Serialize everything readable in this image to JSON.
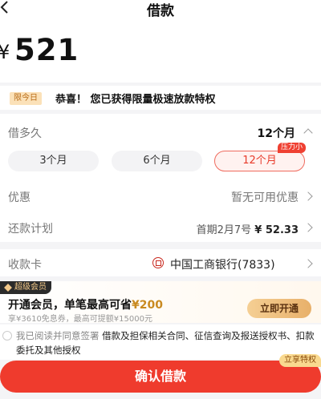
{
  "header": {
    "title": "借款"
  },
  "amount": {
    "currency": "¥",
    "value": "521"
  },
  "promo": {
    "tag": "限今日",
    "text": "恭喜！ 您已获得限量极速放款特权"
  },
  "term": {
    "label": "借多久",
    "selected": "12个月",
    "options": [
      "3个月",
      "6个月",
      "12个月"
    ],
    "badge": "压力小"
  },
  "discount": {
    "label": "优惠",
    "value": "暂无可用优惠"
  },
  "repay": {
    "label": "还款计划",
    "prefix": "首期2月7号 ",
    "value": "¥ 52.33"
  },
  "card": {
    "label": "收款卡",
    "bank": "中国工商银行(7833)"
  },
  "vip": {
    "badge": "超级会员",
    "title_prefix": "开通会员，单笔最高可省",
    "title_price": "¥200",
    "subtitle": "享¥3610免息券，最高可提额¥15000元",
    "button": "立即开通"
  },
  "agreement": {
    "prefix": "我已阅读并同意签署 ",
    "docs": "借款及担保相关合同、征信查询及报送授权书、扣款委托及其他授权"
  },
  "confirm": {
    "label": "确认借款",
    "tag": "立享特权"
  },
  "colors": {
    "primary": "#ef3b2d",
    "gold": "#c98a20"
  }
}
